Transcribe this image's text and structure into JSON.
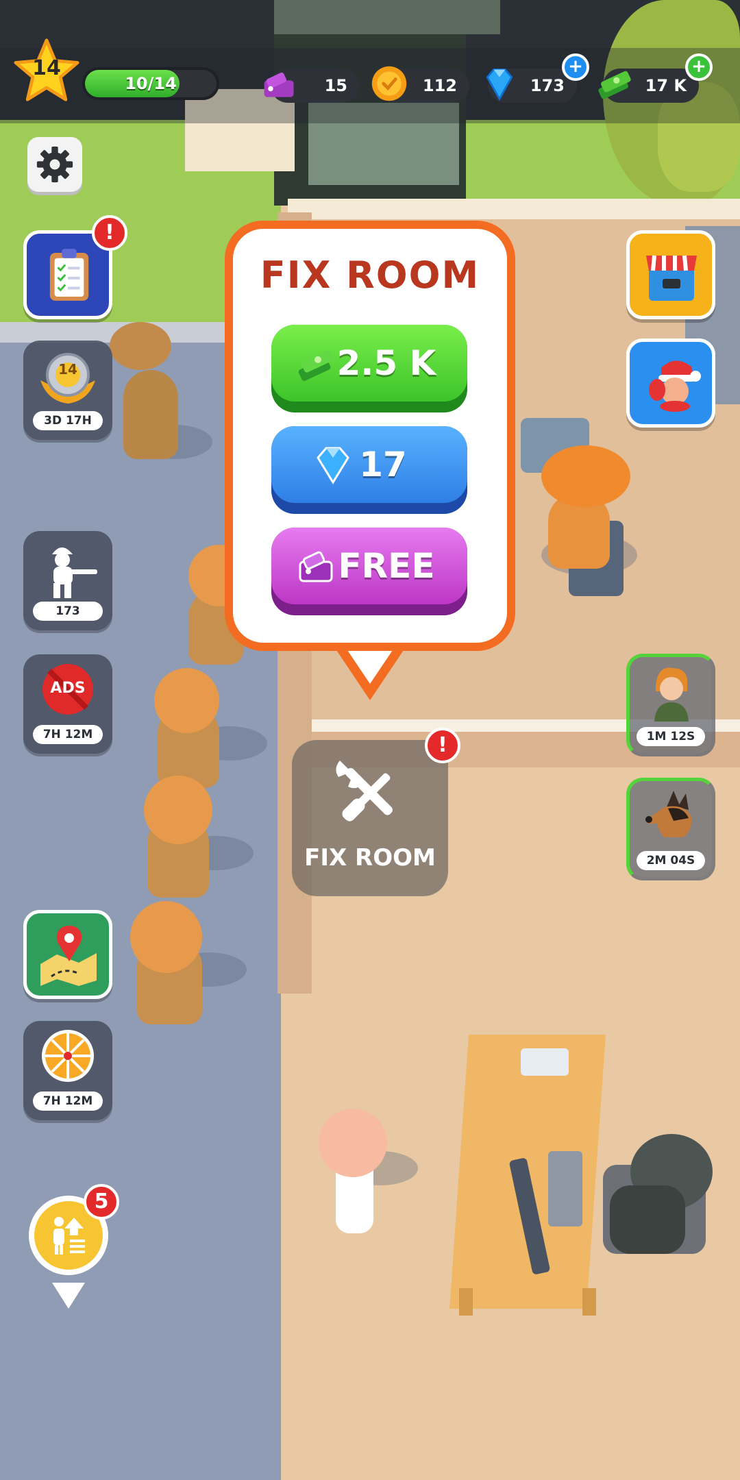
{
  "hud": {
    "level": "14",
    "xp_text": "10/14",
    "xp_fraction": 0.72,
    "tickets": "15",
    "coins": "112",
    "gems": "173",
    "cash": "17 K"
  },
  "left_buttons": {
    "event_timer": "3D 17H",
    "event_level": "14",
    "soldiers_count": "173",
    "ads_label": "ADS",
    "ads_timer": "7H 12M",
    "wheel_timer": "7H 12M",
    "upgrade_badge": "5"
  },
  "alerts": {
    "tasks": "!",
    "fix_room": "!"
  },
  "popup": {
    "title": "FIX ROOM",
    "cash_price": "2.5 K",
    "gem_price": "17",
    "free_label": "FREE"
  },
  "fix_marker": {
    "label": "FIX ROOM"
  },
  "right_timers": {
    "recruit_timer": "1M 12S",
    "dog_timer": "2M 04S"
  },
  "colors": {
    "popup_border": "#f36c21",
    "title": "#b8371e",
    "cash_button": "#42c92b",
    "gem_button": "#2f7fe6",
    "free_button": "#c13cc8",
    "alert": "#e32929"
  },
  "icons": [
    "star-icon",
    "ticket-icon",
    "coin-icon",
    "gem-icon",
    "cash-icon",
    "gear-icon",
    "clipboard-icon",
    "badge-icon",
    "soldier-icon",
    "ads-icon",
    "map-icon",
    "wheel-icon",
    "upgrade-icon",
    "shop-icon",
    "santa-icon",
    "wrench-screwdriver-icon",
    "recruit-icon",
    "dog-icon"
  ]
}
